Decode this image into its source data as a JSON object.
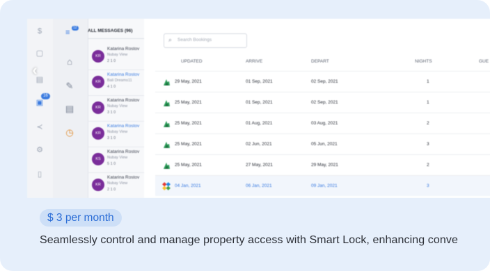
{
  "rail": {
    "badge": "16"
  },
  "messages": {
    "header": "ALL MESSAGES (96)",
    "badge": "12",
    "items": [
      {
        "initials": "KR",
        "name": "Katarina Rostov",
        "sub": "Nubay View",
        "meta": "2 1 0",
        "blue": false
      },
      {
        "initials": "KR",
        "name": "Katarina Rostov",
        "sub": "Bali Dreams11",
        "meta": "4 1 0",
        "blue": true
      },
      {
        "initials": "KR",
        "name": "Katarina Rostov",
        "sub": "Nubay View",
        "meta": "3 1 0",
        "blue": false
      },
      {
        "initials": "KR",
        "name": "Katarina Rostov",
        "sub": "Nubay View",
        "meta": "3 1 0",
        "blue": true
      },
      {
        "initials": "KS",
        "name": "Katarina Rostov",
        "sub": "Nubay View",
        "meta": "5 1 0",
        "blue": false
      },
      {
        "initials": "KR",
        "name": "Katarina Rostov",
        "sub": "Nubay View",
        "meta": "2 1 0",
        "blue": false
      }
    ]
  },
  "table": {
    "search_placeholder": "Search Bookings",
    "columns": {
      "updated": "UPDATED",
      "arrive": "ARRIVE",
      "depart": "DEPART",
      "nights": "NIGHTS",
      "guests": "GUE"
    },
    "rows": [
      {
        "updated": "29 May, 2021",
        "arrive": "01 Sep, 2021",
        "depart": "02 Sep, 2021",
        "nights": "1",
        "source": "green"
      },
      {
        "updated": "25 May, 2021",
        "arrive": "01 Sep, 2021",
        "depart": "02 Sep, 2021",
        "nights": "1",
        "source": "green"
      },
      {
        "updated": "25 May, 2021",
        "arrive": "01 Aug, 2021",
        "depart": "03 Aug, 2021",
        "nights": "2",
        "source": "green"
      },
      {
        "updated": "25 May, 2021",
        "arrive": "02 Jun, 2021",
        "depart": "05 Jun, 2021",
        "nights": "3",
        "source": "green"
      },
      {
        "updated": "25 May, 2021",
        "arrive": "27 May, 2021",
        "depart": "29 May, 2021",
        "nights": "2",
        "source": "green"
      },
      {
        "updated": "04 Jan, 2021",
        "arrive": "06 Jan, 2021",
        "depart": "09 Jan, 2021",
        "nights": "3",
        "source": "multi",
        "blue": true
      }
    ]
  },
  "promo": {
    "price": "$ 3 per month",
    "description": "Seamlessly control and manage property access with  Smart Lock, enhancing conve"
  },
  "colors": {
    "accent": "#3a7be0",
    "avatar": "#7a2d9a",
    "panel": "#e6effb"
  }
}
